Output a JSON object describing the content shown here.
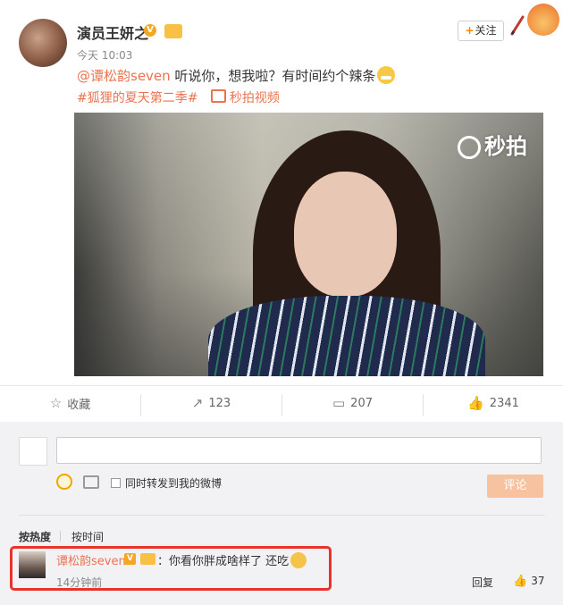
{
  "author": {
    "name": "演员王妍之",
    "vip_badge": "V",
    "post_time": "今天 10:03",
    "follow_label": "关注",
    "follow_plus": "+"
  },
  "post": {
    "mention": "@谭松韵seven",
    "text": " 听说你，想我啦？有时间约个辣条",
    "topic": "#狐狸的夏天第二季#",
    "video_label": "秒拍视频",
    "watermark": "秒拍"
  },
  "actions": {
    "favorite": "收藏",
    "repost": "123",
    "comment": "207",
    "like": "2341"
  },
  "composer": {
    "repost_label": "同时转发到我的微博",
    "submit_label": "评论"
  },
  "sort": {
    "hot": "按热度",
    "time": "按时间"
  },
  "comment": {
    "author": "谭松韵seven",
    "vip_badge": "V",
    "text": "：你看你胖成啥样了 还吃",
    "time": "14分钟前",
    "reply_label": "回复",
    "like_count": "37"
  },
  "colors": {
    "accent": "#eb7350",
    "highlight": "#e8322c",
    "submit_disabled": "#f7c2a0"
  },
  "icons": [
    "star-icon",
    "repost-icon",
    "comment-icon",
    "thumbs-up-icon",
    "emoji-icon",
    "image-icon",
    "pencil-icon",
    "miaopai-icon"
  ]
}
